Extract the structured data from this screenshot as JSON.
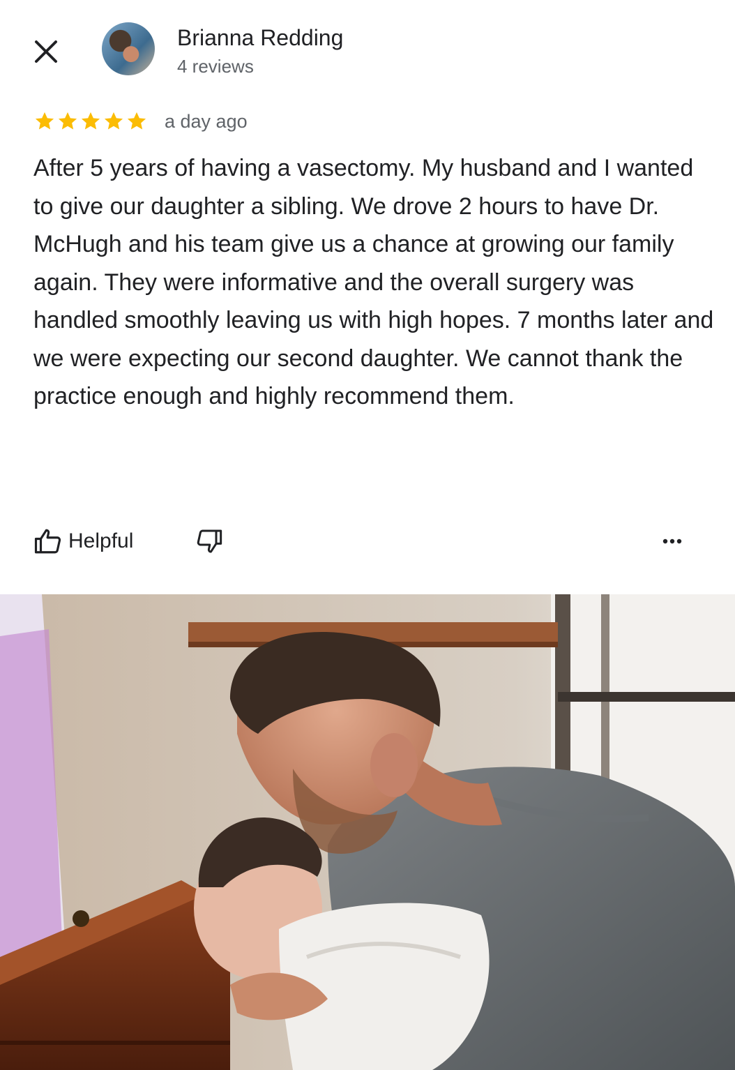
{
  "reviewer": {
    "name": "Brianna Redding",
    "reviews_count": "4 reviews"
  },
  "rating": {
    "stars": 5,
    "max": 5,
    "star_color": "#fbbc04"
  },
  "time_ago": "a day ago",
  "review_text": "After 5 years of having a vasectomy. My husband and I wanted to give our daughter a sibling. We drove 2 hours to have Dr. McHugh and his team give us a chance at growing our family again. They were informative and the overall surgery was handled smoothly leaving us with high hopes. 7 months later and we were expecting our second daughter. We cannot thank the practice enough and highly recommend them.",
  "actions": {
    "helpful_label": "Helpful"
  },
  "icons": {
    "close": "close-icon",
    "like": "thumbs-up-icon",
    "dislike": "thumbs-down-icon",
    "more": "more-horiz-icon",
    "star": "star-icon"
  },
  "colors": {
    "text_primary": "#202124",
    "text_secondary": "#5f6368",
    "background": "#ffffff"
  }
}
